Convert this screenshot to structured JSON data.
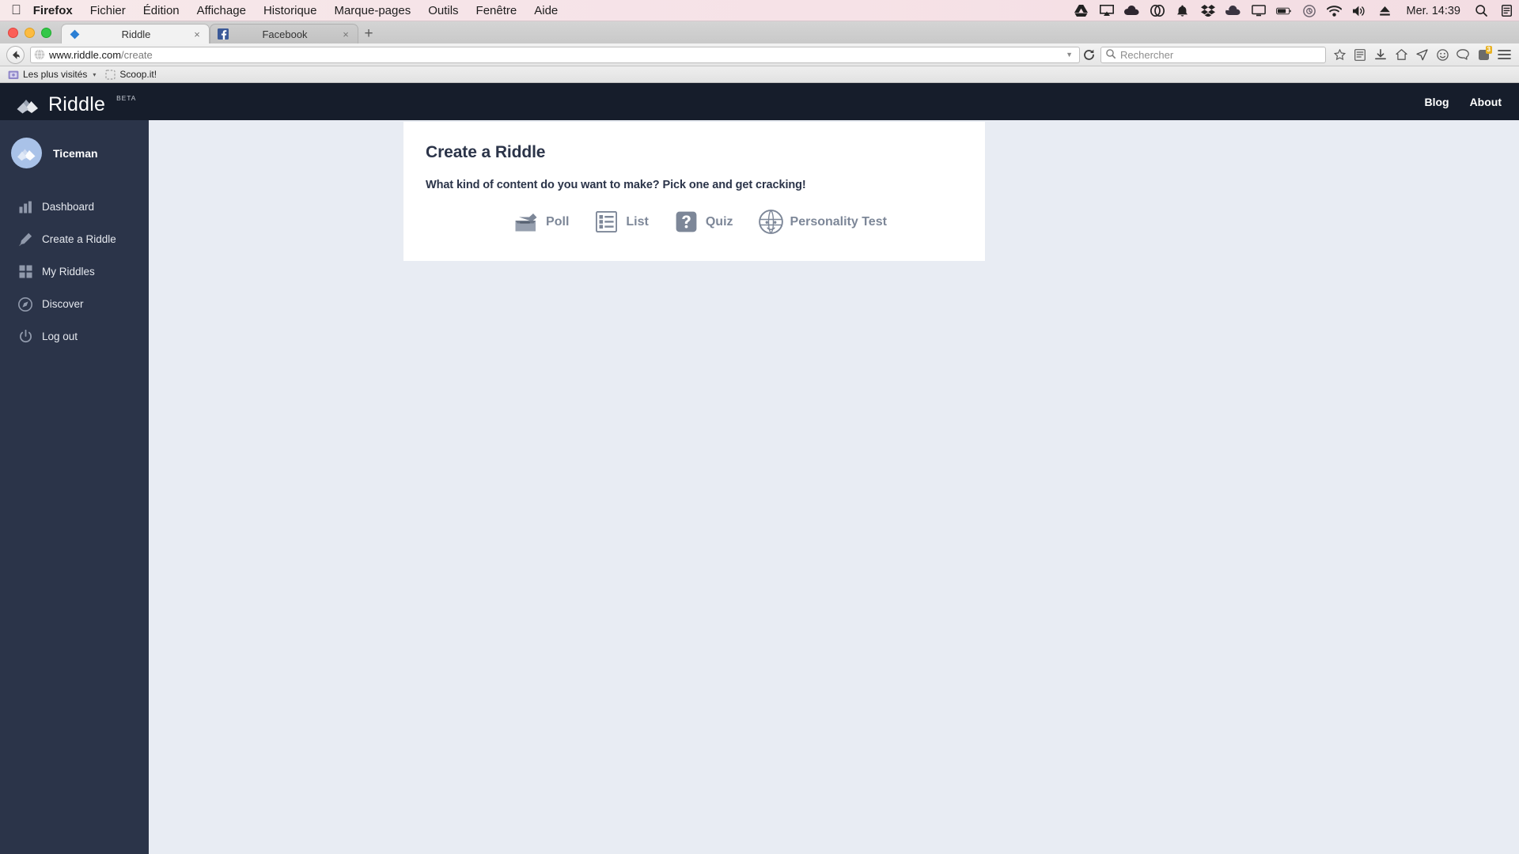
{
  "os_menu": {
    "apple_icon": "apple-logo",
    "items": [
      {
        "label": "Firefox",
        "bold": true
      },
      {
        "label": "Fichier",
        "bold": false
      },
      {
        "label": "Édition",
        "bold": false
      },
      {
        "label": "Affichage",
        "bold": false
      },
      {
        "label": "Historique",
        "bold": false
      },
      {
        "label": "Marque-pages",
        "bold": false
      },
      {
        "label": "Outils",
        "bold": false
      },
      {
        "label": "Fenêtre",
        "bold": false
      },
      {
        "label": "Aide",
        "bold": false
      }
    ],
    "status_icons": [
      "google-drive-icon",
      "airplay-icon",
      "cloud-icon",
      "creative-cloud-icon",
      "bell-icon",
      "dropbox-icon",
      "cloud-sync-icon",
      "display-icon",
      "battery-icon",
      "time-machine-icon",
      "wifi-icon",
      "volume-icon",
      "eject-icon"
    ],
    "clock": "Mer. 14:39",
    "right_icons": [
      "spotlight-search-icon",
      "notification-center-icon"
    ]
  },
  "browser": {
    "window_controls": [
      "close-button",
      "minimize-button",
      "zoom-button"
    ],
    "tabs": [
      {
        "title": "Riddle",
        "favicon": "riddle-diamond-icon",
        "active": true,
        "close": "×"
      },
      {
        "title": "Facebook",
        "favicon": "facebook-icon",
        "active": false,
        "close": "×"
      }
    ],
    "new_tab_label": "+",
    "back_icon": "back-arrow-icon",
    "url": {
      "domain": "www.riddle.com",
      "path": "/create"
    },
    "url_dropdown_icon": "chevron-down-icon",
    "reload_icon": "reload-icon",
    "search": {
      "placeholder": "Rechercher",
      "icon": "search-icon",
      "value": ""
    },
    "toolbar_icons": [
      "bookmark-star-icon",
      "reader-icon",
      "download-icon",
      "home-icon",
      "pocket-icon",
      "smiley-icon",
      "chat-icon",
      "addon-icon",
      "menu-icon"
    ],
    "addon_badge": "3",
    "bookmarks": [
      {
        "label": "Les plus visités",
        "icon": "most-visited-icon",
        "caret": "▾"
      },
      {
        "label": "Scoop.it!",
        "icon": "scoopit-icon",
        "caret": ""
      }
    ]
  },
  "site": {
    "brand": {
      "name": "Riddle",
      "beta": "BETA",
      "mark": "riddle-logo-icon"
    },
    "header_links": [
      {
        "label": "Blog"
      },
      {
        "label": "About"
      }
    ]
  },
  "sidebar": {
    "user": {
      "name": "Ticeman",
      "avatar": "riddle-avatar-icon"
    },
    "items": [
      {
        "label": "Dashboard",
        "icon": "bar-chart-icon"
      },
      {
        "label": "Create a Riddle",
        "icon": "pencil-icon"
      },
      {
        "label": "My Riddles",
        "icon": "grid-icon"
      },
      {
        "label": "Discover",
        "icon": "compass-icon"
      },
      {
        "label": "Log out",
        "icon": "power-icon"
      }
    ]
  },
  "main": {
    "title": "Create a Riddle",
    "subtitle": "What kind of content do you want to make? Pick one and get cracking!",
    "options": [
      {
        "label": "Poll",
        "icon": "ballot-box-icon"
      },
      {
        "label": "List",
        "icon": "list-icon"
      },
      {
        "label": "Quiz",
        "icon": "question-mark-icon"
      },
      {
        "label": "Personality Test",
        "icon": "personality-face-icon"
      }
    ]
  },
  "colors": {
    "header_bg": "#161d2b",
    "sidebar_bg": "#2b3449",
    "page_bg": "#e8ecf3",
    "card_bg": "#ffffff",
    "accent_text": "#2b3449",
    "muted_label": "#7d8798",
    "avatar_bg": "#a9c2e8"
  }
}
